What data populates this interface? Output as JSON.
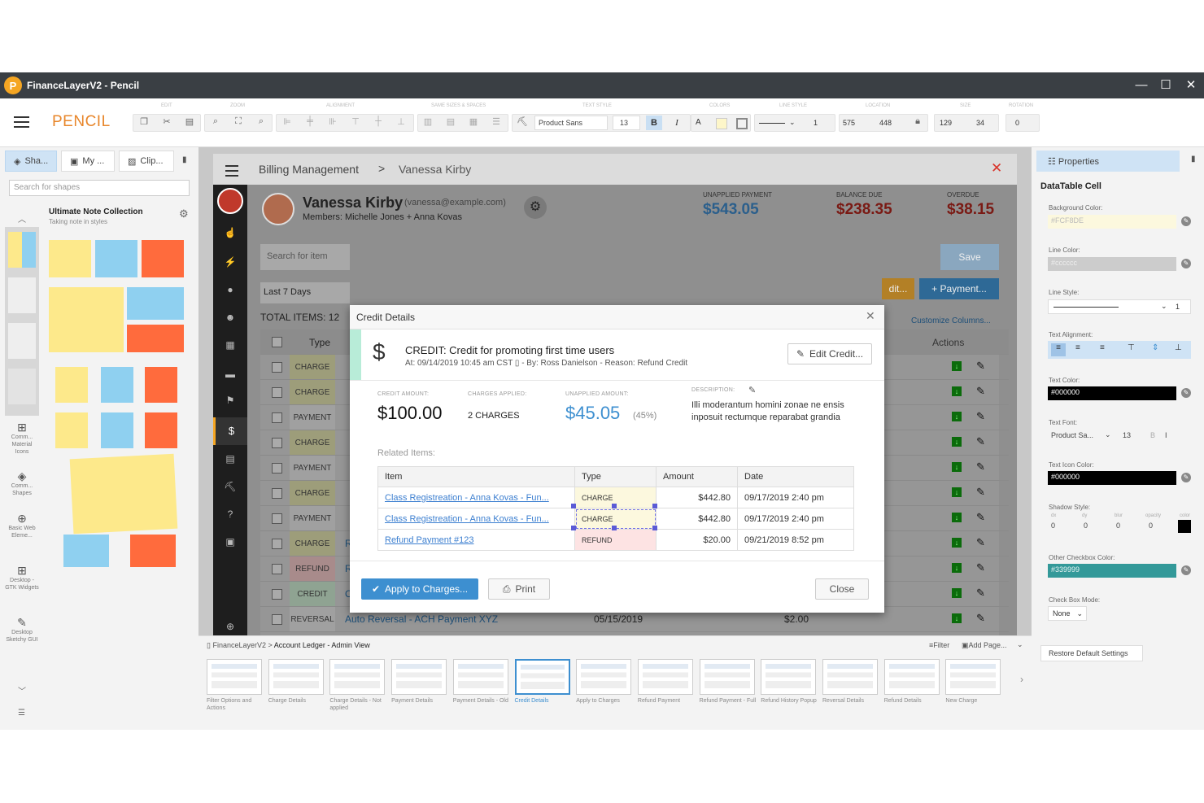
{
  "window": {
    "title": "FinanceLayerV2 - Pencil",
    "logo_letter": "P",
    "minimize": "—",
    "maximize": "☐",
    "close": "✕"
  },
  "toolbar": {
    "brand": "PENCIL",
    "section_labels": [
      "Edit",
      "Zoom",
      "Alignment",
      "Same sizes & spaces",
      "Text style",
      "Colors",
      "Line style",
      "Location",
      "Size",
      "Rotation"
    ],
    "font": "Product Sans",
    "font_size": "13",
    "bold": "B",
    "italic": "I",
    "text_color": "A",
    "line_width": "1",
    "x": "575",
    "y": "448",
    "width": "129",
    "height": "34",
    "rotation": "0"
  },
  "left_panel": {
    "tabs": [
      "Sha...",
      "My ...",
      "Clip..."
    ],
    "search_placeholder": "Search for shapes",
    "collection_title": "Ultimate Note Collection",
    "collection_subtitle": "Taking note in styles",
    "categories": [
      "Comm... Material Icons",
      "Comm... Shapes",
      "Basic Web Eleme...",
      "Desktop - GTK Widgets",
      "Desktop Sketchy GUI"
    ]
  },
  "mockup": {
    "breadcrumb": {
      "root": "Billing Management",
      "sep": ">",
      "current": "Vanessa Kirby"
    },
    "customer": {
      "name": "Vanessa Kirby",
      "email": "(vanessa@example.com)",
      "members": "Members: Michelle Jones + Anna Kovas"
    },
    "stats": [
      {
        "label": "UNAPPLIED PAYMENT",
        "value": "$543.05",
        "color": "#4a90c8"
      },
      {
        "label": "BALANCE DUE",
        "value": "$238.35",
        "color": "#d9342b"
      },
      {
        "label": "OVERDUE",
        "value": "$38.15",
        "color": "#d9342b"
      }
    ],
    "search_placeholder": "Search for item",
    "date_filter": "Last 7 Days",
    "total_items": "TOTAL ITEMS: 12",
    "save": "Save",
    "credit_btn": "dit...",
    "payment_btn": "+ Payment...",
    "customize": "Customize Columns...",
    "table": {
      "headers": {
        "type": "Type",
        "actions": "Actions"
      },
      "rows": [
        {
          "type": "CHARGE",
          "item": "",
          "date": "",
          "due": "",
          "amount": "",
          "balance": ""
        },
        {
          "type": "CHARGE",
          "item": "",
          "date": "",
          "due": "",
          "amount": "",
          "balance": ""
        },
        {
          "type": "PAYMENT",
          "item": "",
          "date": "",
          "due": "",
          "amount": "",
          "balance": ""
        },
        {
          "type": "CHARGE",
          "item": "",
          "date": "",
          "due": "",
          "amount": "",
          "balance": ""
        },
        {
          "type": "PAYMENT",
          "item": "",
          "date": "",
          "due": "",
          "amount": "",
          "balance": ""
        },
        {
          "type": "CHARGE",
          "item": "",
          "date": "",
          "due": "",
          "amount": "",
          "balance": ""
        },
        {
          "type": "PAYMENT",
          "item": "",
          "date": "",
          "due": "",
          "amount": "",
          "balance": ""
        },
        {
          "type": "CHARGE",
          "item": "Registration Fee - Michelle Jones",
          "date": "06/23/2019",
          "due": "09/22/2019",
          "amount": "$2,189.22",
          "balance": "$2,189.22"
        },
        {
          "type": "REFUND",
          "item": "Refund for payment XXX",
          "date": "06/23/2019",
          "due": "",
          "amount": "$180.00",
          "balance": ""
        },
        {
          "type": "CREDIT",
          "item": "Credit: Refund for payment XXX",
          "date": "06/22/2019",
          "due": "",
          "amount": "$2,189.22",
          "balance": ""
        },
        {
          "type": "REVERSAL",
          "item": "Auto Reversal - ACH Payment XYZ",
          "date": "05/15/2019",
          "due": "",
          "amount": "$2.00",
          "balance": ""
        }
      ]
    }
  },
  "modal": {
    "title": "Credit Details",
    "close_x": "✕",
    "heading": "CREDIT: Credit for promoting first time users",
    "meta": "At: 09/14/2019 10:45 am CST",
    "meta_by": "- By: Ross Danielson - Reason: Refund Credit",
    "edit": "Edit Credit...",
    "credit_amount_label": "CREDIT AMOUNT:",
    "credit_amount": "$100.00",
    "charges_applied_label": "CHARGES APPLIED:",
    "charges_applied": "2 CHARGES",
    "unapplied_label": "UNAPPLIED AMOUNT:",
    "unapplied": "$45.05",
    "unapplied_pct": "(45%)",
    "description_label": "DESCRIPTION:",
    "description": "Illi moderantum homini zonae ne ensis inposuit rectumque reparabat grandia",
    "related_label": "Related Items:",
    "related_headers": [
      "Item",
      "Type",
      "Amount",
      "Date"
    ],
    "related": [
      {
        "item": "Class Registreation - Anna Kovas - Fun...",
        "type": "CHARGE",
        "amount": "$442.80",
        "date": "09/17/2019 2:40 pm"
      },
      {
        "item": "Class Registreation - Anna Kovas - Fun...",
        "type": "CHARGE",
        "amount": "$442.80",
        "date": "09/17/2019 2:40 pm"
      },
      {
        "item": "Refund Payment #123",
        "type": "REFUND",
        "amount": "$20.00",
        "date": "09/21/2019 8:52 pm"
      }
    ],
    "apply": "Apply to Charges...",
    "print": "Print",
    "close": "Close"
  },
  "properties": {
    "tab": "Properties",
    "title": "DataTable Cell",
    "background_color_label": "Background Color:",
    "background_color": "#FCF8DE",
    "line_color_label": "Line Color:",
    "line_color": "#cccccc",
    "line_style_label": "Line Style:",
    "line_style_value": "1",
    "text_align_label": "Text Alignment:",
    "text_color_label": "Text Color:",
    "text_color": "#000000",
    "text_font_label": "Text Font:",
    "text_font": "Product Sa...",
    "text_font_size": "13",
    "text_font_b": "B",
    "text_font_i": "I",
    "text_icon_color_label": "Text Icon Color:",
    "text_icon_color": "#000000",
    "shadow_label": "Shadow Style:",
    "shadow_sub": [
      "dx",
      "dy",
      "blur",
      "opacity",
      "color"
    ],
    "shadow_values": [
      "0",
      "0",
      "0",
      "0"
    ],
    "other_checkbox_label": "Other Checkbox Color:",
    "other_checkbox_color": "#339999",
    "checkbox_mode_label": "Check Box Mode:",
    "checkbox_mode": "None",
    "restore": "Restore Default Settings"
  },
  "pages": {
    "breadcrumb": [
      "FinanceLayerV2",
      ">",
      "Account Ledger - Admin View"
    ],
    "filter": "Filter",
    "add_page": "Add Page...",
    "items": [
      "Filter Options and Actions",
      "Charge Details",
      "Charge Details - Not applied",
      "Payment Details",
      "Payment Details - Old",
      "Credit Details",
      "Apply to Charges",
      "Refund Payment",
      "Refund Payment - Full",
      "Refund History Popup",
      "Reversal Details",
      "Refund Details",
      "New Charge"
    ],
    "active_index": 5
  }
}
